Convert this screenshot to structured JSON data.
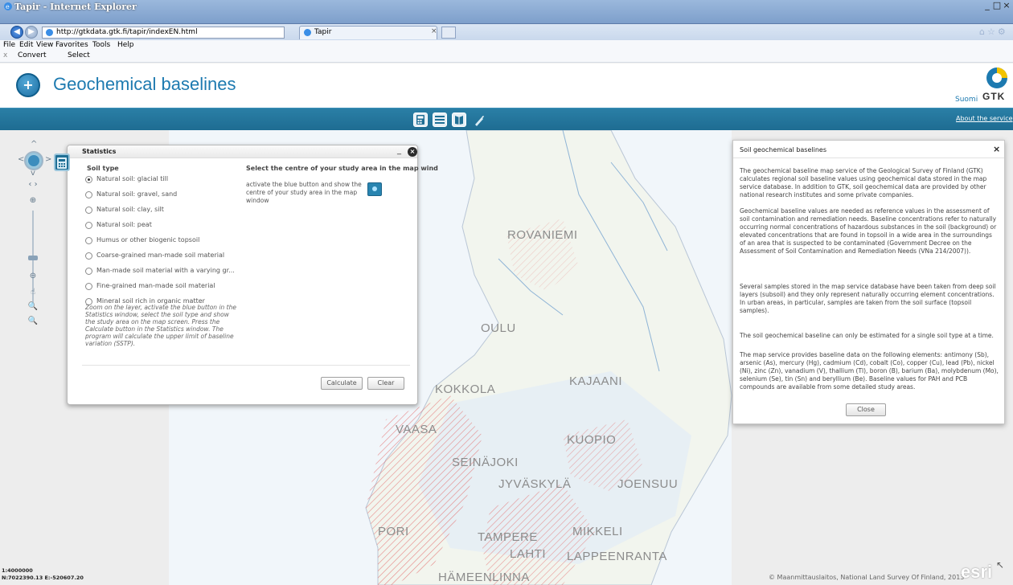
{
  "browser": {
    "window_title": "Tapir - Internet Explorer",
    "address": "http://gtkdata.gtk.fi/tapir/indexEN.html",
    "tab_label": "Tapir",
    "tab_close": "×",
    "menu": [
      "File",
      "Edit",
      "View",
      "Favorites",
      "Tools",
      "Help"
    ],
    "command_close": "x",
    "command_convert": "Convert",
    "command_select": "Select"
  },
  "app": {
    "title": "Geochemical baselines",
    "language_link": "Suomi",
    "logo_text": "GTK",
    "about_link": "About the service"
  },
  "statistics": {
    "title": "Statistics",
    "soil_type_label": "Soil type",
    "options": [
      "Natural soil: glacial till",
      "Natural soil: gravel, sand",
      "Natural soil: clay, silt",
      "Natural soil: peat",
      "Humus or other biogenic topsoil",
      "Coarse-grained man-made soil material",
      "Man-made soil material with a varying gr...",
      "Fine-grained man-made soil material",
      "Mineral soil rich in organic matter"
    ],
    "selected_index": 0,
    "help_text": "Zoom on the layer, activate the blue button in the Statistics window, select the soil type and show the study area on the map screen. Press the Calculate button in the Statistics window. The program will calculate the upper limit of baseline variation (SSTP).",
    "heading": "Select the centre of your study area in the map wind",
    "instruction": "activate the blue button and show the centre of your study area in the map window",
    "calculate_label": "Calculate",
    "clear_label": "Clear"
  },
  "info": {
    "title": "Soil geochemical baselines",
    "paragraphs": [
      "The geochemical baseline map service of the Geological Survey of Finland (GTK) calculates regional soil baseline values using geochemical data stored in the map service database. In addition to GTK, soil geochemical data are provided by other national research institutes and some private companies.",
      "Geochemical baseline values are needed as reference values in the assessment of soil contamination and remediation needs. Baseline concentrations refer to naturally occurring normal concentrations of hazardous substances in the soil (background) or elevated concentrations that are found in topsoil in a wide area in the surroundings of an area that is suspected to be contaminated (Government Decree on the Assessment of Soil Contamination and Remediation Needs (VNa 214/2007)).",
      "Several samples stored in the map service database have been taken from deep soil layers (subsoil) and they only represent naturally occurring element concentrations. In urban areas, in particular, samples are taken from the soil surface (topsoil samples).",
      "The soil geochemical baseline can only be estimated for a single soil type at a time.",
      "The map service provides baseline data on the following elements: antimony (Sb), arsenic (As), mercury (Hg), cadmium (Cd), cobalt (Co), copper (Cu), lead (Pb), nickel (Ni), zinc (Zn), vanadium (V), thallium (Tl), boron (B), barium (Ba), molybdenum (Mo), selenium (Se), tin (Sn) and beryllium (Be). Baseline values for PAH and PCB compounds are available from some detailed study areas."
    ],
    "close_label": "Close"
  },
  "map": {
    "cities": [
      "ROVANIEMI",
      "OULU",
      "KOKKOLA",
      "KAJAANI",
      "VAASA",
      "KUOPIO",
      "SEINÄJOKI",
      "JYVÄSKYLÄ",
      "JOENSUU",
      "PORI",
      "TAMPERE",
      "MIKKELI",
      "LAHTI",
      "LAPPEENRANTA",
      "HÄMEENLINNA"
    ],
    "scale": "1:4000000",
    "coordinates": "N:7022390.13 E:-520607.20",
    "copyright": "© Maanmittauslaitos, National Land Survey Of Finland, 2013",
    "esri": "esri"
  },
  "colors": {
    "accent": "#1d7ab0",
    "toolbar": "#226f96",
    "hatch": "#e26b6b"
  }
}
